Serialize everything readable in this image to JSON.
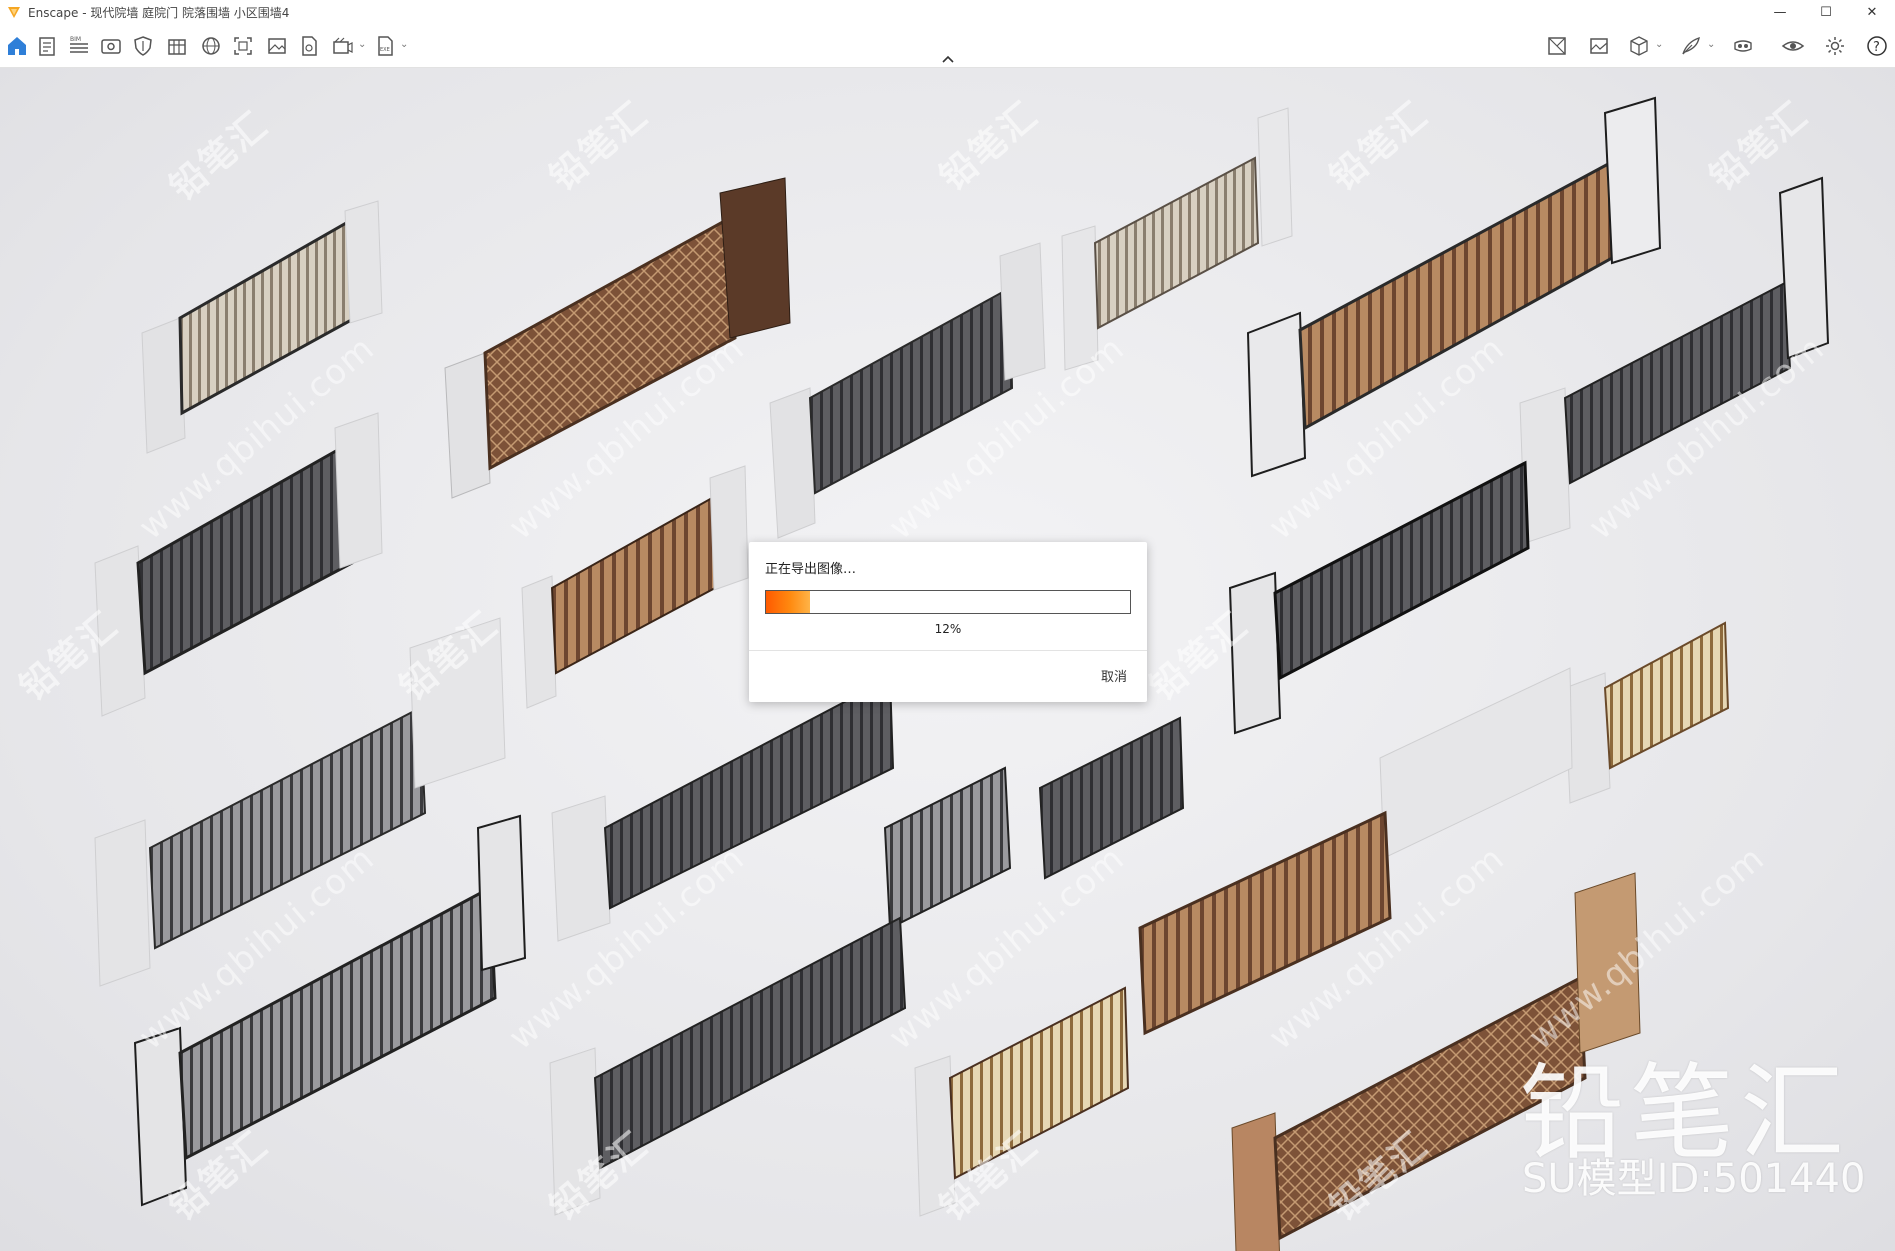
{
  "window": {
    "title": "Enscape - 现代院墙 庭院门 院落围墙 小区围墙4",
    "controls": [
      "—",
      "☐",
      "✕"
    ]
  },
  "toolbar": {
    "left_icons": [
      "home-icon",
      "document-icon",
      "bim-icon",
      "eye-icon",
      "shield-icon",
      "library-icon",
      "globe-icon",
      "screenshot-icon",
      "image-icon",
      "file-export-icon",
      "video-icon",
      "exe-icon"
    ],
    "right_icons": [
      "map-icon",
      "picture-icon",
      "cube-icon",
      "feather-icon",
      "vr-icon",
      "visibility-icon",
      "settings-icon",
      "help-icon"
    ],
    "bim_label": "BIM",
    "exe_label": "EXE",
    "help_label": "?"
  },
  "watermark": {
    "text": "铅笔汇",
    "url": "www.qbihui.com",
    "brand": "铅笔汇",
    "model_id": "SU模型ID:501440"
  },
  "dialog": {
    "title": "正在导出图像…",
    "progress": 0.12,
    "percent_label": "12%",
    "cancel_label": "取消"
  },
  "colors": {
    "accent": "#2f7fd8",
    "progress": "#ff6a00",
    "bronze": "#8a5a3c",
    "dark_metal": "#3a3a3c",
    "stone": "#e4e4e6"
  }
}
